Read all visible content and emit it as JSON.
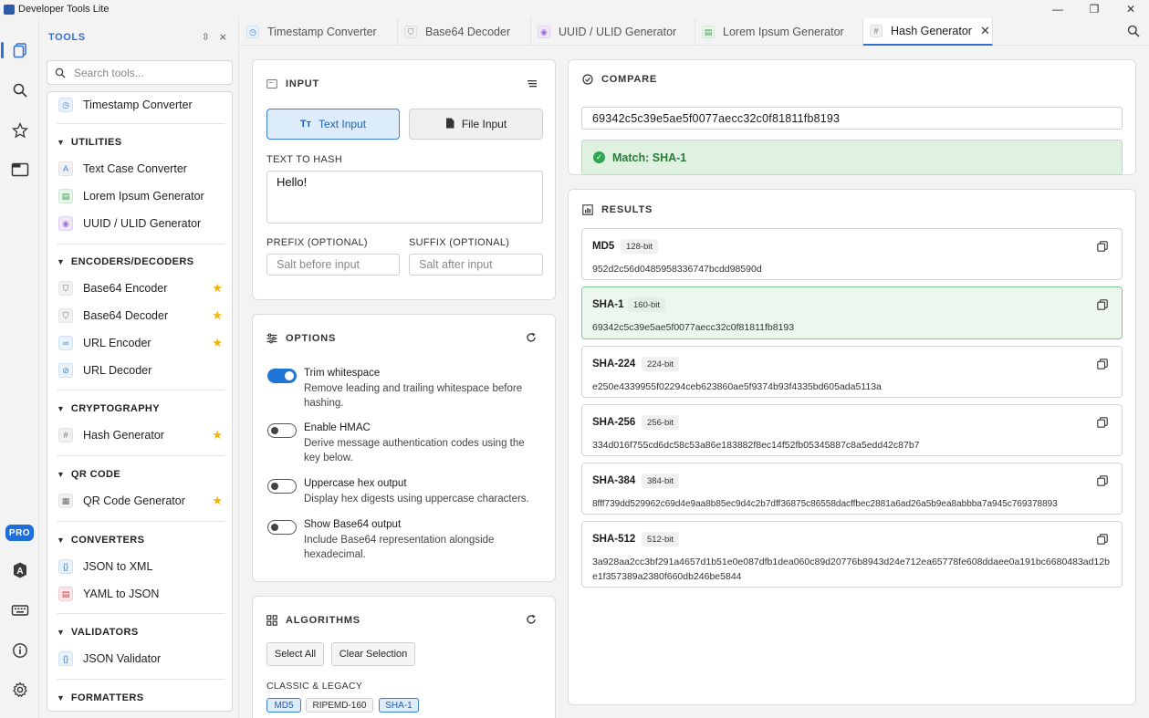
{
  "window": {
    "title": "Developer Tools Lite",
    "controls": [
      "—",
      "❐",
      "✕"
    ]
  },
  "rail": {
    "pro_label": "PRO"
  },
  "sidebar": {
    "header": "TOOLS",
    "search_placeholder": "Search tools...",
    "top_item": "Timestamp Converter",
    "categories": [
      {
        "title": "UTILITIES",
        "items": [
          {
            "label": "Text Case Converter",
            "starred": false
          },
          {
            "label": "Lorem Ipsum Generator",
            "starred": false
          },
          {
            "label": "UUID / ULID Generator",
            "starred": false
          }
        ]
      },
      {
        "title": "ENCODERS/DECODERS",
        "items": [
          {
            "label": "Base64 Encoder",
            "starred": true
          },
          {
            "label": "Base64 Decoder",
            "starred": true
          },
          {
            "label": "URL Encoder",
            "starred": true
          },
          {
            "label": "URL Decoder",
            "starred": false
          }
        ]
      },
      {
        "title": "CRYPTOGRAPHY",
        "items": [
          {
            "label": "Hash Generator",
            "starred": true
          }
        ]
      },
      {
        "title": "QR CODE",
        "items": [
          {
            "label": "QR Code Generator",
            "starred": true
          }
        ]
      },
      {
        "title": "CONVERTERS",
        "items": [
          {
            "label": "JSON to XML",
            "starred": false
          },
          {
            "label": "YAML to JSON",
            "starred": false
          }
        ]
      },
      {
        "title": "VALIDATORS",
        "items": [
          {
            "label": "JSON Validator",
            "starred": false
          }
        ]
      },
      {
        "title": "FORMATTERS",
        "items": []
      }
    ]
  },
  "tabs": [
    {
      "label": "Timestamp Converter",
      "active": false
    },
    {
      "label": "Base64 Decoder",
      "active": false
    },
    {
      "label": "UUID / ULID Generator",
      "active": false
    },
    {
      "label": "Lorem Ipsum Generator",
      "active": false
    },
    {
      "label": "Hash Generator",
      "active": true
    }
  ],
  "input_panel": {
    "title": "INPUT",
    "text_input_label": "Text Input",
    "file_input_label": "File Input",
    "text_to_hash_label": "TEXT TO HASH",
    "text_value": "Hello!",
    "prefix_label": "PREFIX (OPTIONAL)",
    "prefix_placeholder": "Salt before input",
    "suffix_label": "SUFFIX (OPTIONAL)",
    "suffix_placeholder": "Salt after input"
  },
  "options_panel": {
    "title": "OPTIONS",
    "options": [
      {
        "title": "Trim whitespace",
        "desc": "Remove leading and trailing whitespace before hashing.",
        "on": true
      },
      {
        "title": "Enable HMAC",
        "desc": "Derive message authentication codes using the key below.",
        "on": false
      },
      {
        "title": "Uppercase hex output",
        "desc": "Display hex digests using uppercase characters.",
        "on": false
      },
      {
        "title": "Show Base64 output",
        "desc": "Include Base64 representation alongside hexadecimal.",
        "on": false
      }
    ]
  },
  "algorithms_panel": {
    "title": "ALGORITHMS",
    "select_all": "Select All",
    "clear_selection": "Clear Selection",
    "group_label": "CLASSIC & LEGACY",
    "chips": [
      "MD5",
      "RIPEMD-160",
      "SHA-1"
    ]
  },
  "compare_panel": {
    "title": "COMPARE",
    "value": "69342c5c39e5ae5f0077aecc32c0f81811fb8193",
    "match_text": "Match: SHA-1"
  },
  "results_panel": {
    "title": "RESULTS",
    "results": [
      {
        "name": "MD5",
        "bits": "128-bit",
        "value": "952d2c56d0485958336747bcdd98590d",
        "highlight": false
      },
      {
        "name": "SHA-1",
        "bits": "160-bit",
        "value": "69342c5c39e5ae5f0077aecc32c0f81811fb8193",
        "highlight": true
      },
      {
        "name": "SHA-224",
        "bits": "224-bit",
        "value": "e250e4339955f02294ceb623860ae5f9374b93f4335bd605ada5113a",
        "highlight": false
      },
      {
        "name": "SHA-256",
        "bits": "256-bit",
        "value": "334d016f755cd6dc58c53a86e183882f8ec14f52fb05345887c8a5edd42c87b7",
        "highlight": false
      },
      {
        "name": "SHA-384",
        "bits": "384-bit",
        "value": "8fff739dd529962c69d4e9aa8b85ec9d4c2b7dff36875c86558dacffbec2881a6ad26a5b9ea8abbba7a945c769378893",
        "highlight": false
      },
      {
        "name": "SHA-512",
        "bits": "512-bit",
        "value": "3a928aa2cc3bf291a4657d1b51e0e087dfb1dea060c89d20776b8943d24e712ea65778fe608ddaee0a191bc6680483ad12be1f357389a2380f660db246be5844",
        "highlight": false
      }
    ]
  }
}
